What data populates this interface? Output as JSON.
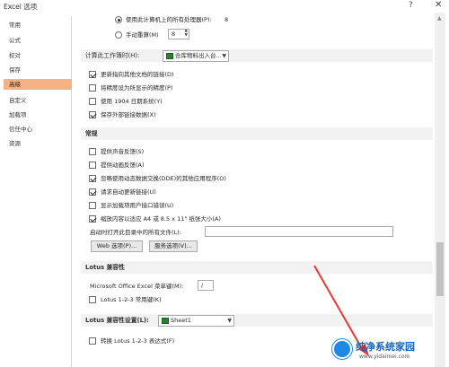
{
  "window": {
    "title": "Excel 选项",
    "help": "?",
    "close": "✕"
  },
  "sidebar": {
    "items": [
      {
        "label": "常用"
      },
      {
        "label": "公式"
      },
      {
        "label": "校对"
      },
      {
        "label": "保存"
      },
      {
        "label": "高级",
        "active": true
      },
      {
        "label": "自定义"
      },
      {
        "label": "加载项"
      },
      {
        "label": "信任中心"
      },
      {
        "label": "资源"
      }
    ]
  },
  "calc": {
    "use_all_processors_label": "使用此计算机上的所有处理器(P):",
    "use_all_processors_value": "8",
    "manual_label": "手动重算(M)",
    "manual_value": "8"
  },
  "workbook_section": {
    "title": "计算此工作簿时(H):",
    "workbook_name": "合库物料出入台...",
    "options": [
      {
        "label": "更新指向其他文档的链接(D)",
        "checked": true
      },
      {
        "label": "将精度设为所显示的精度(P)",
        "checked": false
      },
      {
        "label": "使用 1904 日期系统(Y)",
        "checked": false
      },
      {
        "label": "保存外部链接数据(X)",
        "checked": true
      }
    ]
  },
  "general_section": {
    "title": "常规",
    "options": [
      {
        "label": "提供声音反馈(S)",
        "checked": false
      },
      {
        "label": "提供动画反馈(A)",
        "checked": false
      },
      {
        "label": "忽略使用动态数据交换(DDE)的其他应用程序(O)",
        "checked": true
      },
      {
        "label": "请求自动更新链接(U)",
        "checked": true
      },
      {
        "label": "显示加载项用户接口错误(U)",
        "checked": false
      },
      {
        "label": "缩放内容以适应 A4 或 8.5 x 11\" 纸张大小(A)",
        "checked": true
      }
    ],
    "startup_label": "启动时打开此目录中的所有文件(L):",
    "startup_value": "",
    "web_options_button": "Web 选项(P)...",
    "service_options_button": "服务选项(V)..."
  },
  "lotus_section": {
    "title": "Lotus 兼容性",
    "menu_key_label": "Microsoft Office Excel 菜单键(M):",
    "menu_key_value": "/",
    "nav_keys_label": "Lotus 1-2-3 常用键(K)",
    "nav_keys_checked": false
  },
  "lotus_settings_section": {
    "title": "Lotus 兼容性设置(L):",
    "sheet_name": "Sheet1",
    "formula_label": "转换 Lotus 1-2-3 表达式(F)",
    "formula_checked": false
  },
  "watermark": {
    "title": "纯净系统家园",
    "url": "www.yidaimei.com"
  }
}
